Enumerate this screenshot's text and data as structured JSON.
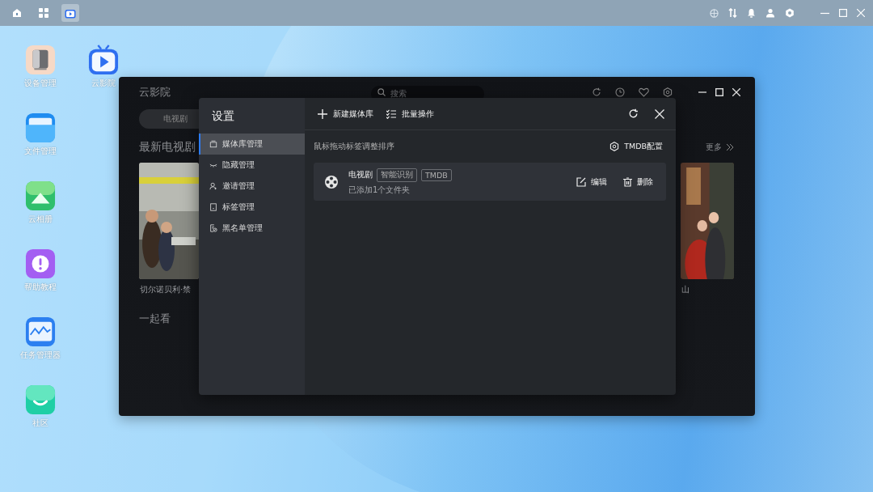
{
  "taskbar": {
    "apps": [
      {
        "kind": "home",
        "selected": false
      },
      {
        "kind": "grid",
        "selected": false
      },
      {
        "kind": "player",
        "selected": true
      }
    ],
    "tray": [
      {
        "kind": "globe"
      },
      {
        "kind": "transfer"
      },
      {
        "kind": "bell"
      },
      {
        "kind": "user"
      },
      {
        "kind": "settings"
      }
    ]
  },
  "desktop_icons": [
    {
      "kind": "device",
      "label": "设备管理"
    },
    {
      "kind": "folder",
      "label": "文件管理"
    },
    {
      "kind": "photos",
      "label": "云相册"
    },
    {
      "kind": "help",
      "label": "帮助教程"
    },
    {
      "kind": "monitor",
      "label": "任务管理器"
    },
    {
      "kind": "community",
      "label": "社区"
    },
    {
      "kind": "player",
      "label": "云影院"
    }
  ],
  "app_window": {
    "title": "云影院",
    "search": {
      "placeholder": "搜索"
    },
    "tabs": [
      {
        "label": "电视剧",
        "selected": true
      }
    ],
    "section_title": "最新电视剧",
    "more": "更多",
    "posters": [
      {
        "caption": "切尔诺贝利·禁"
      },
      {
        "caption": "山"
      }
    ],
    "section2_title": "一起看"
  },
  "settings": {
    "title": "设置",
    "menu": [
      {
        "label": "媒体库管理",
        "kind": "library",
        "selected": true
      },
      {
        "label": "隐藏管理",
        "kind": "hide",
        "selected": false
      },
      {
        "label": "邀请管理",
        "kind": "invite",
        "selected": false
      },
      {
        "label": "标签管理",
        "kind": "tag",
        "selected": false
      },
      {
        "label": "黑名单管理",
        "kind": "blacklist",
        "selected": false
      }
    ],
    "toolbar": [
      {
        "kind": "add",
        "label": "新建媒体库"
      },
      {
        "kind": "batch",
        "label": "批量操作"
      }
    ],
    "hint": "鼠标拖动标签调整排序",
    "tmdb_button": "TMDB配置",
    "libraries": [
      {
        "name": "电视剧",
        "tags": [
          "智能识别",
          "TMDB"
        ],
        "subtitle": "已添加1个文件夹",
        "actions": [
          {
            "kind": "edit",
            "label": "编辑"
          },
          {
            "kind": "delete",
            "label": "删除"
          }
        ]
      }
    ]
  }
}
